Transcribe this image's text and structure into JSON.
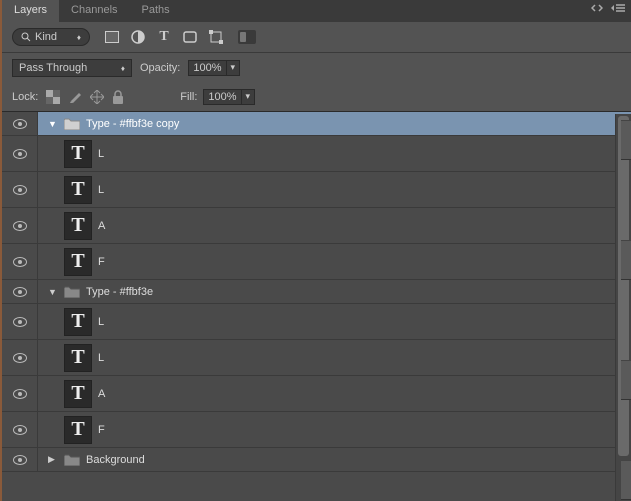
{
  "tabs": {
    "layers": "Layers",
    "channels": "Channels",
    "paths": "Paths"
  },
  "filter": {
    "kind": "Kind"
  },
  "blend": {
    "mode": "Pass Through",
    "opacity_label": "Opacity:",
    "opacity_value": "100%"
  },
  "lock": {
    "label": "Lock:",
    "fill_label": "Fill:",
    "fill_value": "100%"
  },
  "layers": {
    "group1": {
      "name": "Type - #ffbf3e copy"
    },
    "g1_l1": {
      "name": "L"
    },
    "g1_l2": {
      "name": "L"
    },
    "g1_l3": {
      "name": "A"
    },
    "g1_l4": {
      "name": "F"
    },
    "group2": {
      "name": "Type - #ffbf3e"
    },
    "g2_l1": {
      "name": "L"
    },
    "g2_l2": {
      "name": "L"
    },
    "g2_l3": {
      "name": "A"
    },
    "g2_l4": {
      "name": "F"
    },
    "bg": {
      "name": "Background"
    }
  }
}
